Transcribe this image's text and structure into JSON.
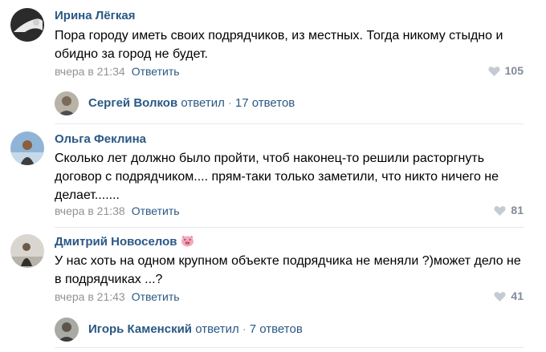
{
  "comments": [
    {
      "author": "Ирина Лёгкая",
      "text": "Пора городу иметь своих подрядчиков, из местных. Тогда никому стыдно и обидно за город не будет.",
      "time": "вчера в 21:34",
      "reply_label": "Ответить",
      "likes": "105",
      "thread": {
        "name": "Сергей Волков",
        "replied": "ответил",
        "count": "17 ответов"
      }
    },
    {
      "author": "Ольга Феклина",
      "text": "Сколько лет должно было пройти, чтоб наконец-то решили расторгнуть договор с подрядчиком.... прям-таки только заметили, что никто ничего не делает.......",
      "time": "вчера в 21:38",
      "reply_label": "Ответить",
      "likes": "81"
    },
    {
      "author": "Дмитрий Новоселов",
      "author_emoji": "pig-face-icon",
      "text": "У нас хоть на одном крупном объекте подрядчика не меняли ?)может дело не в подрядчиках ...?",
      "time": "вчера в 21:43",
      "reply_label": "Ответить",
      "likes": "41",
      "thread": {
        "name": "Игорь Каменский",
        "replied": "ответил",
        "count": "7 ответов"
      }
    }
  ],
  "colors": {
    "link": "#2a5885",
    "meta": "#939393",
    "likes": "#828a99",
    "separator": "#e7e8ec"
  }
}
